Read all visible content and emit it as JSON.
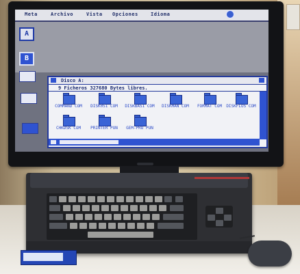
{
  "menu": {
    "items": [
      "Meta",
      "Archivo",
      "Vista",
      "Opciones",
      "Idioma"
    ]
  },
  "drives": [
    {
      "letter": "A",
      "selected": false
    },
    {
      "letter": "B",
      "selected": true
    }
  ],
  "window": {
    "title": "Disco  A:",
    "info": "9 Ficheros   327680 Bytes libres."
  },
  "files": [
    {
      "name": "COMMAND COM"
    },
    {
      "name": "DISK0S1 COM"
    },
    {
      "name": "DISKBAS1 COM"
    },
    {
      "name": "DISKMAN COM"
    },
    {
      "name": "FORMAT  COM"
    },
    {
      "name": "DISKFLOS COM"
    },
    {
      "name": "CHKDSK  COM"
    },
    {
      "name": "PRINTER PUN"
    },
    {
      "name": "GEM-PRO PUN"
    }
  ],
  "colors": {
    "desktop": "#6f7280",
    "gem_blue": "#2f53d1",
    "menubar": "#e3e4ea"
  }
}
